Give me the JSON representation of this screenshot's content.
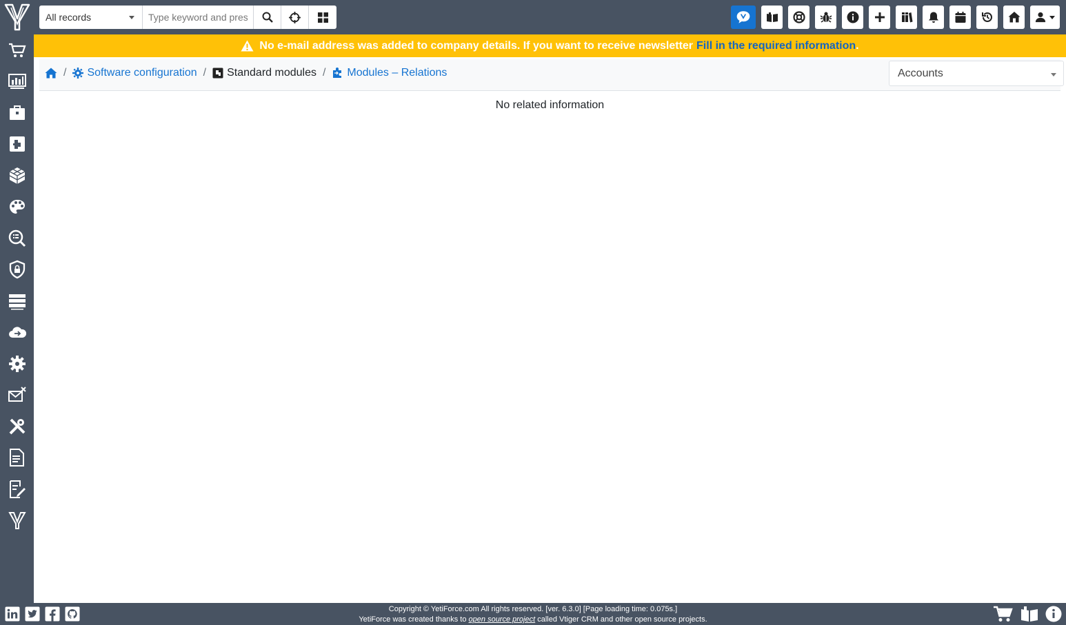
{
  "topbar": {
    "search_scope": "All records",
    "search_placeholder": "Type keyword and press"
  },
  "alert": {
    "message": "No e-mail address was added to company details. If you want to receive newsletter",
    "link_text": "Fill in the required information",
    "trailing": ".",
    "color": "#ffc107"
  },
  "breadcrumb": {
    "item1": "Software configuration",
    "item2": "Standard modules",
    "item3": "Modules – Relations"
  },
  "module_select": {
    "value": "Accounts"
  },
  "content": {
    "empty_message": "No related information"
  },
  "footer": {
    "line1": "Copyright © YetiForce.com All rights reserved. [ver. 6.3.0] [Page loading time: 0.075s.]",
    "line2_pre": "YetiForce was created thanks to",
    "line2_link": "open source project",
    "line2_post": "called Vtiger CRM and other open source projects."
  },
  "colors": {
    "sidebar": "#485362",
    "accent": "#1674d1",
    "alert": "#ffc107"
  }
}
